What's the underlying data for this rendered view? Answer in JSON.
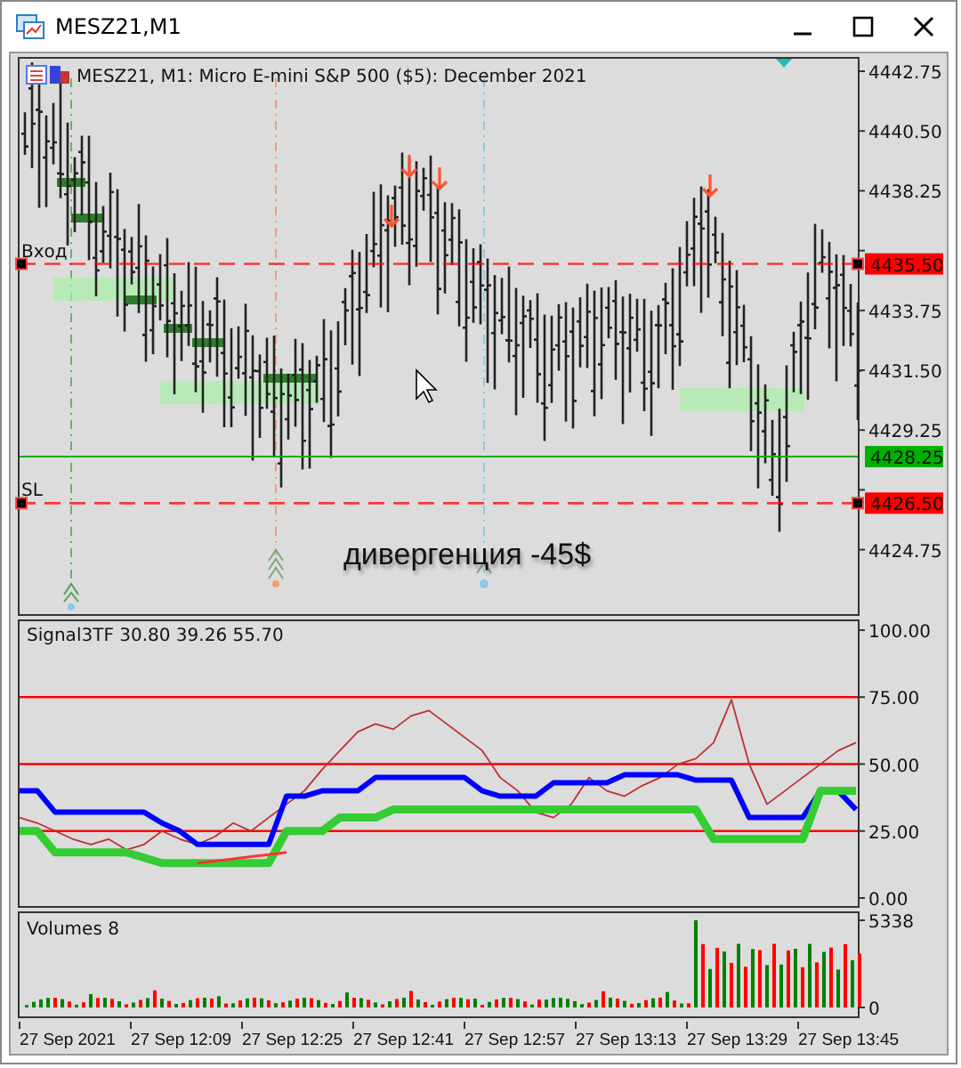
{
  "window": {
    "title": "MESZ21,M1"
  },
  "main_panel": {
    "header": "MESZ21, M1:  Micro E-mini S&P 500 ($5): December 2021",
    "price_axis": [
      "4442.75",
      "4440.50",
      "4438.25",
      "4433.75",
      "4431.50",
      "4429.25",
      "4424.75"
    ],
    "levels": [
      {
        "kind": "dashed",
        "label": "Вход",
        "price": "4435.50",
        "color": "#ff0000"
      },
      {
        "kind": "solid",
        "price": "4428.25",
        "color": "#00b000"
      },
      {
        "kind": "dashed",
        "label": "SL",
        "price": "4426.50",
        "color": "#ff0000"
      }
    ],
    "annotation": "дивергенция -45$"
  },
  "oscillator": {
    "label": "Signal3TF 30.80 39.26 55.70",
    "chart_data": {
      "type": "line",
      "grid": true,
      "ylim": [
        -3,
        104
      ],
      "yticks": [
        {
          "value": 100,
          "label": "100.00"
        },
        {
          "value": 75,
          "label": "75.00"
        },
        {
          "value": 50,
          "label": "50.00"
        },
        {
          "value": 25,
          "label": "25.00"
        },
        {
          "value": 0,
          "label": "0.00"
        }
      ],
      "series": [
        {
          "color": "#c03030",
          "values": [
            30,
            28,
            25,
            22,
            20,
            22,
            18,
            20,
            25,
            22,
            20,
            23,
            28,
            25,
            30,
            35,
            40,
            48,
            55,
            62,
            65,
            63,
            68,
            70,
            65,
            60,
            55,
            45,
            40,
            32,
            30,
            35,
            45,
            40,
            38,
            42,
            45,
            50,
            52,
            58,
            74,
            50,
            35,
            40,
            45,
            50,
            55,
            58
          ]
        },
        {
          "color": "#0000ff",
          "values": [
            40,
            40,
            32,
            32,
            32,
            32,
            32,
            32,
            28,
            25,
            20,
            20,
            20,
            20,
            20,
            38,
            38,
            40,
            40,
            40,
            45,
            45,
            45,
            45,
            45,
            45,
            40,
            38,
            38,
            38,
            43,
            43,
            43,
            43,
            46,
            46,
            46,
            46,
            44,
            44,
            44,
            30,
            30,
            30,
            30,
            40,
            40,
            33
          ]
        },
        {
          "color": "#33cc33",
          "values": [
            25,
            25,
            17,
            17,
            17,
            17,
            17,
            15,
            13,
            13,
            13,
            13,
            13,
            13,
            13,
            25,
            25,
            25,
            30,
            30,
            30,
            33,
            33,
            33,
            33,
            33,
            33,
            33,
            33,
            33,
            33,
            33,
            33,
            33,
            33,
            33,
            33,
            33,
            33,
            22,
            22,
            22,
            22,
            22,
            22,
            40,
            40,
            40
          ]
        },
        {
          "color": "#ff3333",
          "values": [
            null,
            null,
            null,
            null,
            null,
            null,
            null,
            null,
            null,
            null,
            13,
            13.8,
            14.6,
            15.4,
            16.2,
            17,
            null,
            null,
            null,
            null,
            null,
            null,
            null,
            null,
            null,
            null,
            null,
            null,
            null,
            null,
            null,
            null,
            null,
            null,
            null,
            null,
            null,
            null,
            null,
            null,
            null,
            null,
            null,
            null,
            null,
            null,
            null,
            null
          ]
        }
      ]
    }
  },
  "volumes": {
    "label": "Volumes 8",
    "axis": [
      "5338",
      "0"
    ]
  },
  "time_axis": [
    "27 Sep 2021",
    "27 Sep 12:09",
    "27 Sep 12:25",
    "27 Sep 12:41",
    "27 Sep 12:57",
    "27 Sep 13:13",
    "27 Sep 13:29",
    "27 Sep 13:45"
  ]
}
